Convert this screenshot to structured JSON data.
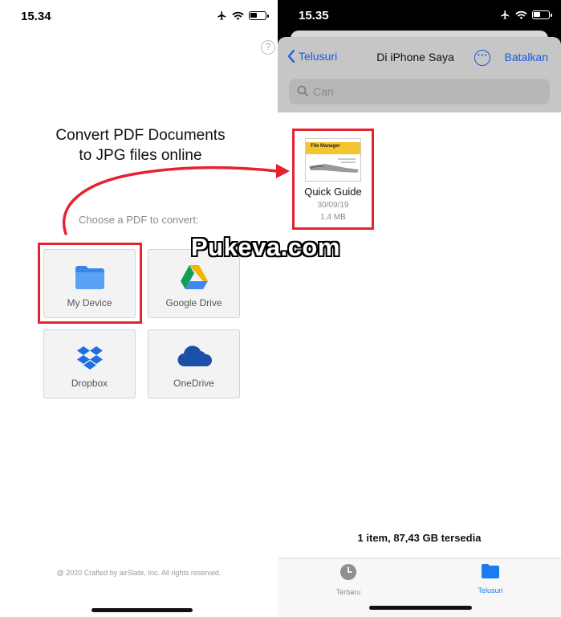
{
  "left": {
    "status": {
      "time": "15.34"
    },
    "help_symbol": "?",
    "headline": "Convert PDF Documents\nto JPG files online",
    "choose_label": "Choose a PDF to convert:",
    "sources": [
      {
        "label": "My Device",
        "icon": "folder-icon"
      },
      {
        "label": "Google Drive",
        "icon": "google-drive-icon"
      },
      {
        "label": "Dropbox",
        "icon": "dropbox-icon"
      },
      {
        "label": "OneDrive",
        "icon": "onedrive-icon"
      }
    ],
    "footer": "@ 2020 Crafted by airSlate, Inc. All rights reserved."
  },
  "right": {
    "status": {
      "time": "15.35"
    },
    "nav": {
      "back_label": "Telusuri",
      "title": "Di iPhone Saya",
      "more_symbol": "···",
      "cancel_label": "Batalkan"
    },
    "search": {
      "placeholder": "Cari"
    },
    "file": {
      "thumb_title": "File Manager",
      "name": "Quick Guide",
      "date": "30/09/19",
      "size": "1,4 MB"
    },
    "storage_text": "1 item, 87,43 GB tersedia",
    "tabs": [
      {
        "label": "Terbaru",
        "icon": "clock-icon",
        "active": false
      },
      {
        "label": "Telusuri",
        "icon": "folder-icon",
        "active": true
      }
    ]
  },
  "watermark": "Pukeva.com",
  "colors": {
    "accent_blue": "#1a5ae0",
    "highlight_red": "#e52330",
    "tab_active": "#1a7cf0",
    "tab_inactive": "#8e8e93"
  }
}
